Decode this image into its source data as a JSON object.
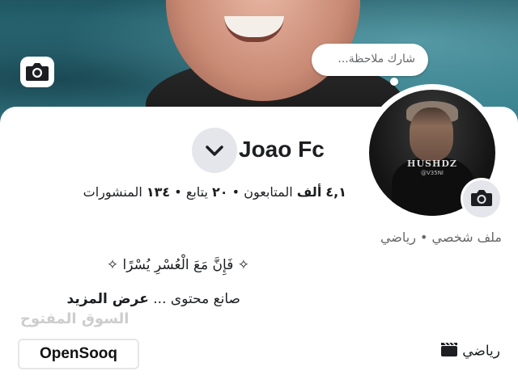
{
  "profile": {
    "name": "Joao Fc",
    "note_prompt": "شارك ملاحظة...",
    "avatar_brand": "HUSHDZ",
    "avatar_handle": "@V35NI",
    "stats": {
      "followers_value": "٤,١",
      "followers_unit": "ألف",
      "followers_label": "المتابعون",
      "separator": "•",
      "following_value": "٢٠",
      "following_label": "يتابع",
      "posts_value": "١٣٤",
      "posts_label": "المنشورات"
    },
    "category_line": "ملف شخصي • رياضي",
    "bio_line1": "✧ فَإِنَّ مَعَ الْعُسْرِ يُسْرًا ✧",
    "bio_line2_text": "صانع محتوى ...",
    "bio_more": "عرض المزيد",
    "tag_label": "رياضي"
  },
  "watermark": {
    "arabic": "السوق المفتوح",
    "english": "OpenSooq"
  },
  "icons": {
    "cover_camera": "camera-icon",
    "avatar_camera": "camera-icon",
    "chevron": "chevron-down-icon",
    "tag": "clapperboard-icon"
  },
  "colors": {
    "text_primary": "#1c1e21",
    "text_secondary": "#65676b",
    "button_gray": "#e4e6eb"
  }
}
